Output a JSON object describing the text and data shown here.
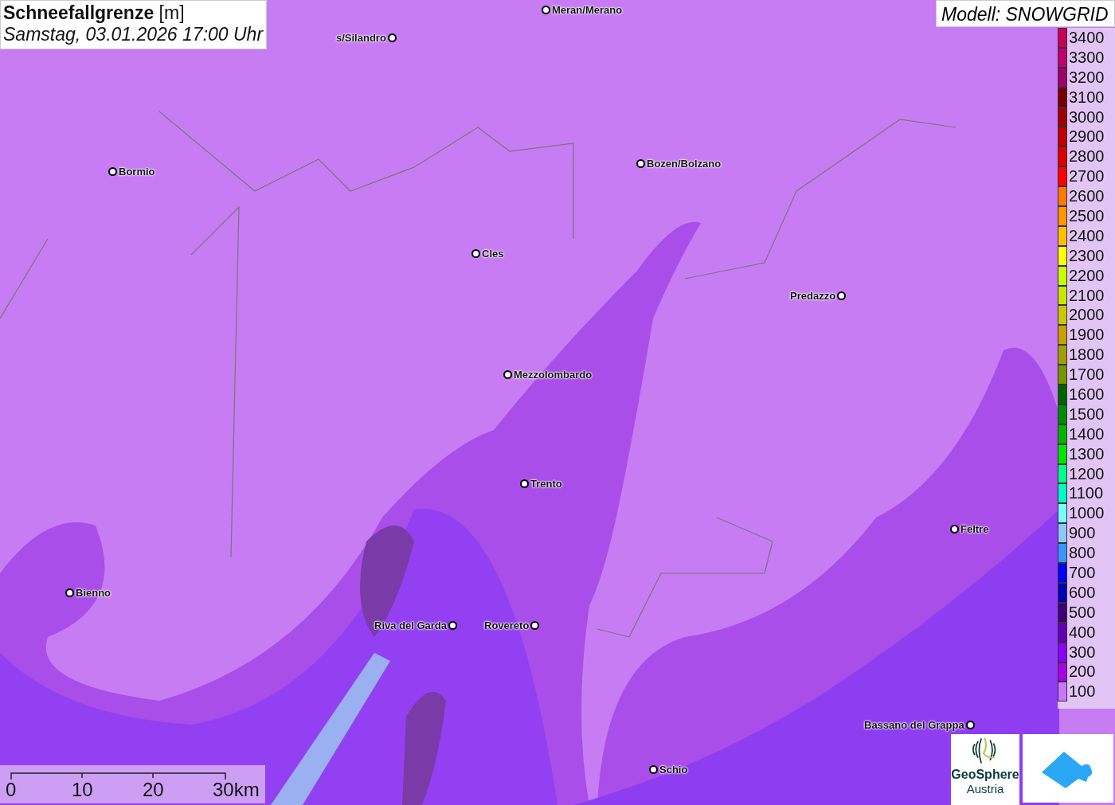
{
  "title": {
    "name": "Schneefallgrenze",
    "unit": "[m]"
  },
  "datetime": "Samstag, 03.01.2026 17:00 Uhr",
  "model": "Modell: SNOWGRID",
  "cities": [
    {
      "name": "Meran/Merano"
    },
    {
      "name": "s/Silandro"
    },
    {
      "name": "Bormio"
    },
    {
      "name": "Bozen/Bolzano"
    },
    {
      "name": "Cles"
    },
    {
      "name": "Predazzo"
    },
    {
      "name": "Mezzolombardo"
    },
    {
      "name": "Trento"
    },
    {
      "name": "Feltre"
    },
    {
      "name": "Bienno"
    },
    {
      "name": "Riva del Garda"
    },
    {
      "name": "Rovereto"
    },
    {
      "name": "Bassano del Grappa"
    },
    {
      "name": "Schio"
    }
  ],
  "legend": [
    {
      "value": "3400",
      "color": "#c8005a"
    },
    {
      "value": "3300",
      "color": "#c0006e"
    },
    {
      "value": "3200",
      "color": "#a0006e"
    },
    {
      "value": "3100",
      "color": "#780000"
    },
    {
      "value": "3000",
      "color": "#a00000"
    },
    {
      "value": "2900",
      "color": "#be0000"
    },
    {
      "value": "2800",
      "color": "#dc0000"
    },
    {
      "value": "2700",
      "color": "#ff0000"
    },
    {
      "value": "2600",
      "color": "#ff7800"
    },
    {
      "value": "2500",
      "color": "#ff9600"
    },
    {
      "value": "2400",
      "color": "#ffc000"
    },
    {
      "value": "2300",
      "color": "#ffff00"
    },
    {
      "value": "2200",
      "color": "#c8ff00"
    },
    {
      "value": "2100",
      "color": "#c8e600"
    },
    {
      "value": "2000",
      "color": "#c8c800"
    },
    {
      "value": "1900",
      "color": "#c8a000"
    },
    {
      "value": "1800",
      "color": "#a0a000"
    },
    {
      "value": "1700",
      "color": "#789600"
    },
    {
      "value": "1600",
      "color": "#006400"
    },
    {
      "value": "1500",
      "color": "#008c00"
    },
    {
      "value": "1400",
      "color": "#00b400"
    },
    {
      "value": "1300",
      "color": "#00e600"
    },
    {
      "value": "1200",
      "color": "#00ff8c"
    },
    {
      "value": "1100",
      "color": "#00ffc8"
    },
    {
      "value": "1000",
      "color": "#78ffff"
    },
    {
      "value": "900",
      "color": "#8cc8ff"
    },
    {
      "value": "800",
      "color": "#3c96ff"
    },
    {
      "value": "700",
      "color": "#0000ff"
    },
    {
      "value": "600",
      "color": "#0000b4"
    },
    {
      "value": "500",
      "color": "#3c0078"
    },
    {
      "value": "400",
      "color": "#6400b4"
    },
    {
      "value": "300",
      "color": "#8c00ff"
    },
    {
      "value": "200",
      "color": "#aa00e6"
    },
    {
      "value": "100",
      "color": "#c878ff"
    }
  ],
  "scale": [
    "0",
    "10",
    "20",
    "30km"
  ],
  "logo": {
    "name": "GeoSphere",
    "country": "Austria"
  }
}
